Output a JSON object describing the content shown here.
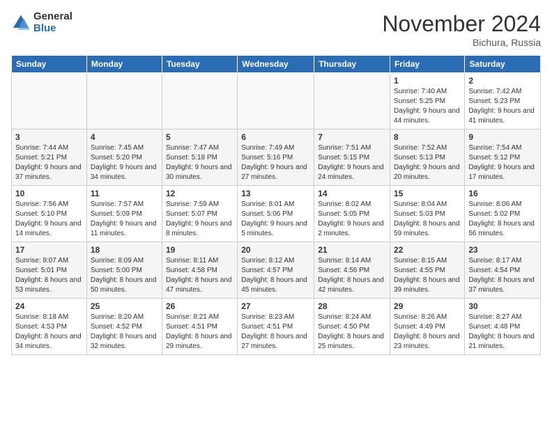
{
  "header": {
    "logo_general": "General",
    "logo_blue": "Blue",
    "month_title": "November 2024",
    "location": "Bichura, Russia"
  },
  "days_of_week": [
    "Sunday",
    "Monday",
    "Tuesday",
    "Wednesday",
    "Thursday",
    "Friday",
    "Saturday"
  ],
  "weeks": [
    [
      {
        "day": "",
        "info": ""
      },
      {
        "day": "",
        "info": ""
      },
      {
        "day": "",
        "info": ""
      },
      {
        "day": "",
        "info": ""
      },
      {
        "day": "",
        "info": ""
      },
      {
        "day": "1",
        "info": "Sunrise: 7:40 AM\nSunset: 5:25 PM\nDaylight: 9 hours and 44 minutes."
      },
      {
        "day": "2",
        "info": "Sunrise: 7:42 AM\nSunset: 5:23 PM\nDaylight: 9 hours and 41 minutes."
      }
    ],
    [
      {
        "day": "3",
        "info": "Sunrise: 7:44 AM\nSunset: 5:21 PM\nDaylight: 9 hours and 37 minutes."
      },
      {
        "day": "4",
        "info": "Sunrise: 7:45 AM\nSunset: 5:20 PM\nDaylight: 9 hours and 34 minutes."
      },
      {
        "day": "5",
        "info": "Sunrise: 7:47 AM\nSunset: 5:18 PM\nDaylight: 9 hours and 30 minutes."
      },
      {
        "day": "6",
        "info": "Sunrise: 7:49 AM\nSunset: 5:16 PM\nDaylight: 9 hours and 27 minutes."
      },
      {
        "day": "7",
        "info": "Sunrise: 7:51 AM\nSunset: 5:15 PM\nDaylight: 9 hours and 24 minutes."
      },
      {
        "day": "8",
        "info": "Sunrise: 7:52 AM\nSunset: 5:13 PM\nDaylight: 9 hours and 20 minutes."
      },
      {
        "day": "9",
        "info": "Sunrise: 7:54 AM\nSunset: 5:12 PM\nDaylight: 9 hours and 17 minutes."
      }
    ],
    [
      {
        "day": "10",
        "info": "Sunrise: 7:56 AM\nSunset: 5:10 PM\nDaylight: 9 hours and 14 minutes."
      },
      {
        "day": "11",
        "info": "Sunrise: 7:57 AM\nSunset: 5:09 PM\nDaylight: 9 hours and 11 minutes."
      },
      {
        "day": "12",
        "info": "Sunrise: 7:59 AM\nSunset: 5:07 PM\nDaylight: 9 hours and 8 minutes."
      },
      {
        "day": "13",
        "info": "Sunrise: 8:01 AM\nSunset: 5:06 PM\nDaylight: 9 hours and 5 minutes."
      },
      {
        "day": "14",
        "info": "Sunrise: 8:02 AM\nSunset: 5:05 PM\nDaylight: 9 hours and 2 minutes."
      },
      {
        "day": "15",
        "info": "Sunrise: 8:04 AM\nSunset: 5:03 PM\nDaylight: 8 hours and 59 minutes."
      },
      {
        "day": "16",
        "info": "Sunrise: 8:06 AM\nSunset: 5:02 PM\nDaylight: 8 hours and 56 minutes."
      }
    ],
    [
      {
        "day": "17",
        "info": "Sunrise: 8:07 AM\nSunset: 5:01 PM\nDaylight: 8 hours and 53 minutes."
      },
      {
        "day": "18",
        "info": "Sunrise: 8:09 AM\nSunset: 5:00 PM\nDaylight: 8 hours and 50 minutes."
      },
      {
        "day": "19",
        "info": "Sunrise: 8:11 AM\nSunset: 4:58 PM\nDaylight: 8 hours and 47 minutes."
      },
      {
        "day": "20",
        "info": "Sunrise: 8:12 AM\nSunset: 4:57 PM\nDaylight: 8 hours and 45 minutes."
      },
      {
        "day": "21",
        "info": "Sunrise: 8:14 AM\nSunset: 4:56 PM\nDaylight: 8 hours and 42 minutes."
      },
      {
        "day": "22",
        "info": "Sunrise: 8:15 AM\nSunset: 4:55 PM\nDaylight: 8 hours and 39 minutes."
      },
      {
        "day": "23",
        "info": "Sunrise: 8:17 AM\nSunset: 4:54 PM\nDaylight: 8 hours and 37 minutes."
      }
    ],
    [
      {
        "day": "24",
        "info": "Sunrise: 8:18 AM\nSunset: 4:53 PM\nDaylight: 8 hours and 34 minutes."
      },
      {
        "day": "25",
        "info": "Sunrise: 8:20 AM\nSunset: 4:52 PM\nDaylight: 8 hours and 32 minutes."
      },
      {
        "day": "26",
        "info": "Sunrise: 8:21 AM\nSunset: 4:51 PM\nDaylight: 8 hours and 29 minutes."
      },
      {
        "day": "27",
        "info": "Sunrise: 8:23 AM\nSunset: 4:51 PM\nDaylight: 8 hours and 27 minutes."
      },
      {
        "day": "28",
        "info": "Sunrise: 8:24 AM\nSunset: 4:50 PM\nDaylight: 8 hours and 25 minutes."
      },
      {
        "day": "29",
        "info": "Sunrise: 8:26 AM\nSunset: 4:49 PM\nDaylight: 8 hours and 23 minutes."
      },
      {
        "day": "30",
        "info": "Sunrise: 8:27 AM\nSunset: 4:48 PM\nDaylight: 8 hours and 21 minutes."
      }
    ]
  ]
}
